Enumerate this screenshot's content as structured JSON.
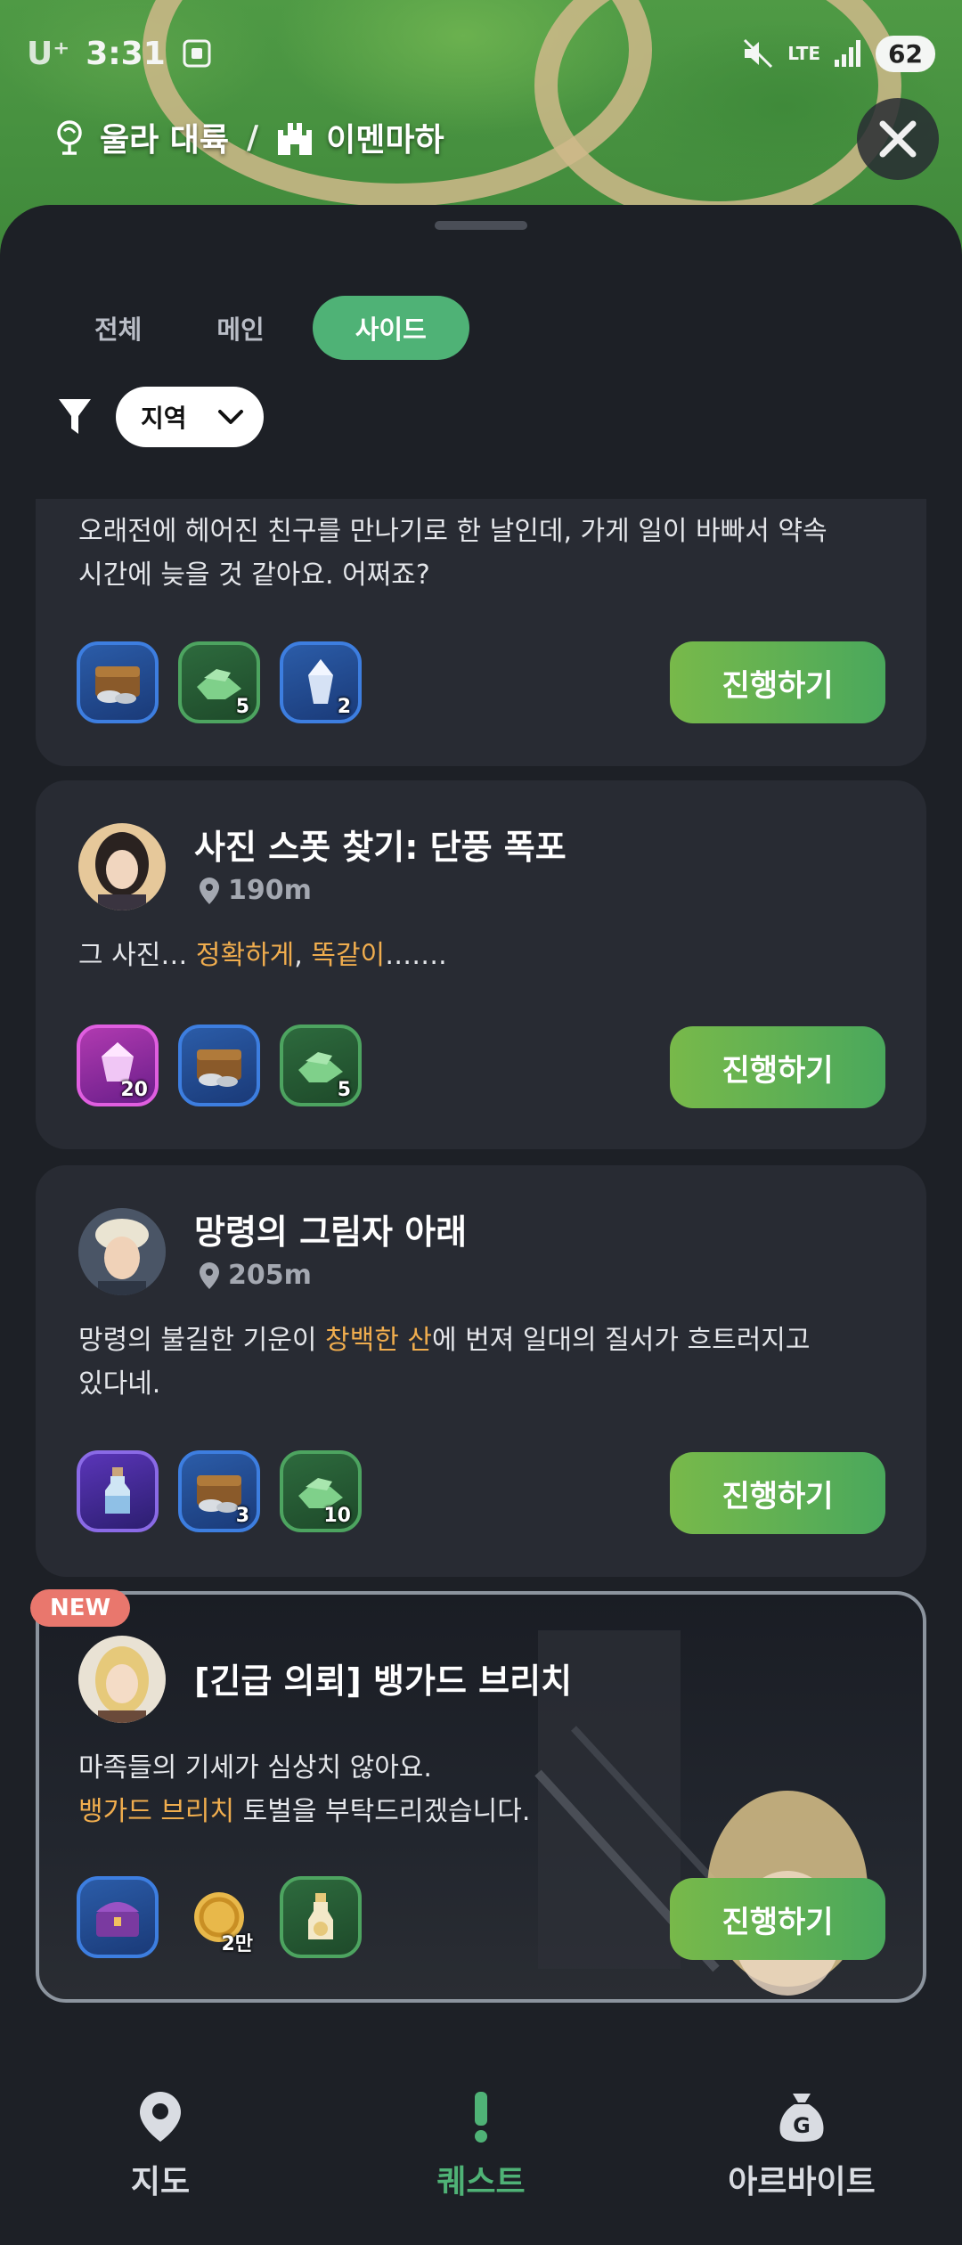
{
  "status_bar": {
    "carrier": "U⁺",
    "time": "3:31",
    "network": "LTE",
    "battery": "62"
  },
  "breadcrumb": {
    "region": "울라 대륙",
    "separator": "/",
    "area": "이멘마하"
  },
  "tabs": [
    {
      "label": "전체",
      "active": false
    },
    {
      "label": "메인",
      "active": false
    },
    {
      "label": "사이드",
      "active": true
    }
  ],
  "filter": {
    "region_label": "지역"
  },
  "quests": [
    {
      "desc_line1": "오래전에 헤어진 친구를 만나기로 한 날인데, 가게 일이 바빠서 약속",
      "desc_line2": "시간에 늦을 것 같아요. 어쩌죠?",
      "rewards": [
        {
          "icon": "treasure-chest-icon",
          "count": ""
        },
        {
          "icon": "green-ore-icon",
          "count": "5"
        },
        {
          "icon": "crystal-shard-icon",
          "count": "2"
        }
      ],
      "button": "진행하기"
    },
    {
      "title": "사진 스폿 찾기: 단풍 폭포",
      "distance": "190m",
      "desc_a": "그 사진… ",
      "desc_hl1": "정확하게",
      "desc_b": ", ",
      "desc_hl2": "똑같이",
      "desc_c": "…….",
      "rewards": [
        {
          "icon": "pink-crystal-icon",
          "count": "20"
        },
        {
          "icon": "treasure-chest-icon",
          "count": ""
        },
        {
          "icon": "green-ore-icon",
          "count": "5"
        }
      ],
      "button": "진행하기"
    },
    {
      "title": "망령의 그림자 아래",
      "distance": "205m",
      "desc_a": "망령의 불길한 기운이 ",
      "desc_hl": "창백한 산",
      "desc_b": "에 번져 일대의 질서가 흐트러지고",
      "desc_line2": "있다네.",
      "rewards": [
        {
          "icon": "potion-bottle-icon",
          "count": ""
        },
        {
          "icon": "treasure-chest-icon",
          "count": "3"
        },
        {
          "icon": "green-ore-icon",
          "count": "10"
        }
      ],
      "button": "진행하기"
    },
    {
      "badge": "NEW",
      "title": "[긴급 의뢰] 뱅가드 브리치",
      "desc_line1": "마족들의 기세가 심상치 않아요.",
      "desc_hl": "뱅가드 브리치",
      "desc_b": " 토벌을 부탁드리겠습니다.",
      "rewards": [
        {
          "icon": "ornate-chest-icon",
          "count": ""
        },
        {
          "icon": "gold-coin-icon",
          "count": "2만"
        },
        {
          "icon": "elixir-flask-icon",
          "count": ""
        }
      ],
      "button": "진행하기"
    }
  ],
  "bottom_nav": [
    {
      "label": "지도",
      "icon": "map-pin-icon",
      "active": false
    },
    {
      "label": "퀘스트",
      "icon": "exclamation-icon",
      "active": true
    },
    {
      "label": "아르바이트",
      "icon": "money-bag-icon",
      "active": false
    }
  ]
}
